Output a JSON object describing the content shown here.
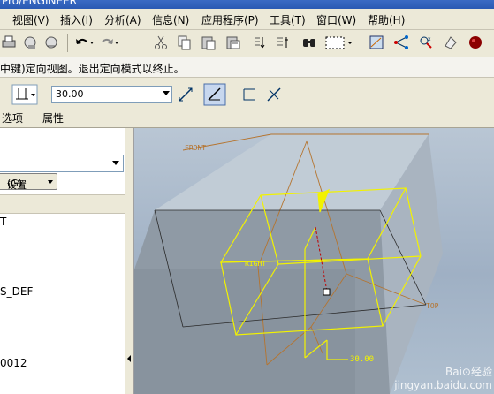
{
  "window": {
    "title": "Pro/ENGINEER"
  },
  "menubar": {
    "items": [
      {
        "label": "视图(V)"
      },
      {
        "label": "插入(I)"
      },
      {
        "label": "分析(A)"
      },
      {
        "label": "信息(N)"
      },
      {
        "label": "应用程序(P)"
      },
      {
        "label": "工具(T)"
      },
      {
        "label": "窗口(W)"
      },
      {
        "label": "帮助(H)"
      }
    ]
  },
  "message": {
    "text": "中键)定向视图。退出定向模式以终止。"
  },
  "dashboard": {
    "value": "30.00",
    "tabs": [
      {
        "label": "选项"
      },
      {
        "label": "属性"
      }
    ]
  },
  "leftpanel": {
    "settings_label": "设置",
    "settings_key": "(G)",
    "tree_items": [
      {
        "label": "T"
      },
      {
        "label": "S_DEF"
      },
      {
        "label": "0012"
      }
    ]
  },
  "viewport": {
    "labels": {
      "front": "FRONT",
      "right": "RIGHT",
      "top": "TOP",
      "dim_value": "30.00"
    },
    "watermark": {
      "brand": "Bai⊙经验",
      "url": "jingyan.baidu.com"
    },
    "colors": {
      "plane_orange": "#b5742e",
      "preview_yellow": "#f2f200",
      "block_top": "#c1ccd6",
      "block_front": "#8f9aa5",
      "block_side": "#a9b4c0"
    }
  }
}
